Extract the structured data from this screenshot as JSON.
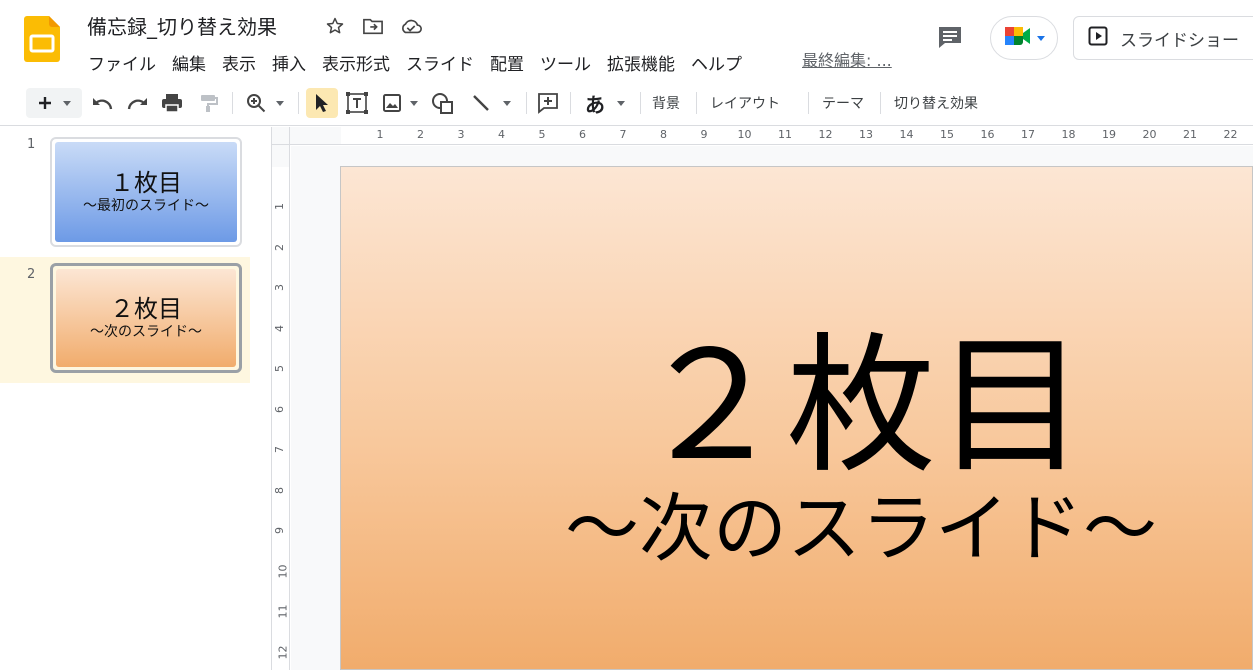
{
  "header": {
    "doc_title": "備忘録_切り替え効果",
    "menu": [
      "ファイル",
      "編集",
      "表示",
      "挿入",
      "表示形式",
      "スライド",
      "配置",
      "ツール",
      "拡張機能",
      "ヘルプ"
    ],
    "last_edit": "最終編集: ...",
    "slideshow_label": "スライドショー",
    "icons": [
      "star-icon",
      "move-to-folder-icon",
      "cloud-saved-icon",
      "comment-icon",
      "meet-icon",
      "present-icon"
    ]
  },
  "toolbar": {
    "background_label": "背景",
    "layout_label": "レイアウト",
    "theme_label": "テーマ",
    "transition_label": "切り替え効果",
    "font_glyph": "あ"
  },
  "filmstrip": {
    "slides": [
      {
        "number": "1",
        "title": "１枚目",
        "subtitle": "～最初のスライド～"
      },
      {
        "number": "2",
        "title": "２枚目",
        "subtitle": "～次のスライド～"
      }
    ]
  },
  "ruler": {
    "h_numbers": [
      "1",
      "2",
      "3",
      "4",
      "5",
      "6",
      "7",
      "8",
      "9",
      "10",
      "11",
      "12",
      "13",
      "14",
      "15",
      "16",
      "17",
      "18",
      "19",
      "20",
      "21",
      "22"
    ],
    "v_numbers": [
      "1",
      "2",
      "3",
      "4",
      "5",
      "6",
      "7",
      "8",
      "9",
      "10",
      "11",
      "12"
    ]
  },
  "slide": {
    "title": "２枚目",
    "subtitle": "～次のスライド～"
  },
  "colors": {
    "accent_yellow": "#fbbc04",
    "slide1_gradient": [
      "#c9dbf7",
      "#6d9ae6"
    ],
    "slide2_gradient": [
      "#fce6d4",
      "#f1ac6c"
    ],
    "selected_bg": "#fef7e0"
  }
}
